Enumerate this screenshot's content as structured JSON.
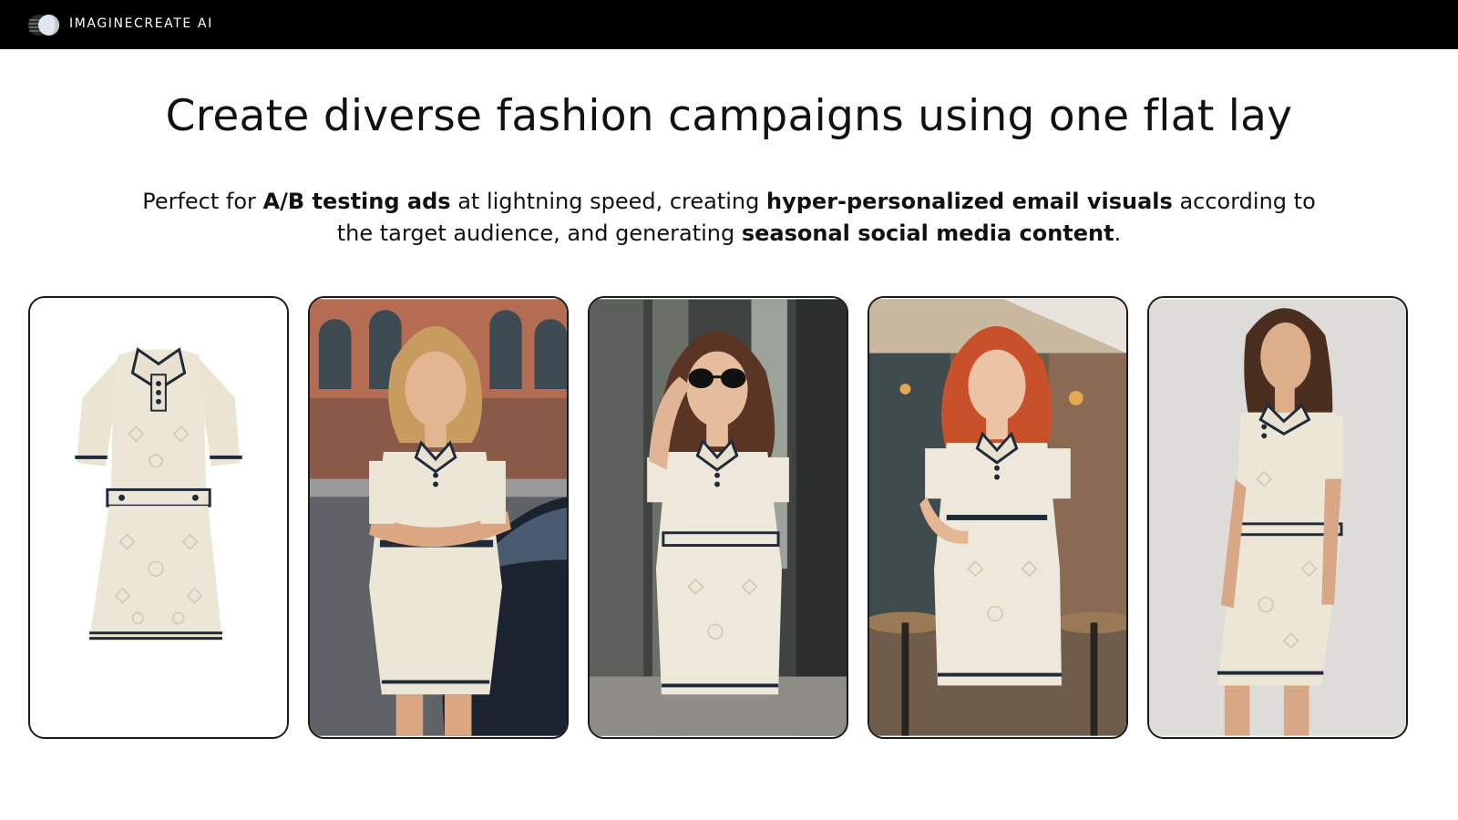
{
  "app": {
    "brand": "IMAGINECREATE AI",
    "logo_icon": "half-moon-logo-icon"
  },
  "hero": {
    "headline": "Create diverse fashion campaigns using one flat lay",
    "subtitle": {
      "p1": "Perfect for ",
      "b1": "A/B testing ads",
      "p2": " at lightning speed, creating ",
      "b2": "hyper-personalized email visuals",
      "p3": " according to the target audience, and generating ",
      "b3": "seasonal social media content",
      "p4": "."
    }
  },
  "gallery": {
    "items": [
      {
        "kind": "flat-lay-product-shot",
        "background": "#ffffff"
      },
      {
        "kind": "model-street-car",
        "background": "#b8745a"
      },
      {
        "kind": "model-sunglasses-storefront",
        "background": "#4b4f4c"
      },
      {
        "kind": "model-cafe-terrace",
        "background": "#6c5a4a"
      },
      {
        "kind": "model-studio-grey",
        "background": "#dcdad6"
      }
    ]
  },
  "colors": {
    "topbar": "#000000",
    "dress_cream": "#ece6d6",
    "dress_trim": "#1f2a3a",
    "card_border": "#1a1a1a"
  }
}
